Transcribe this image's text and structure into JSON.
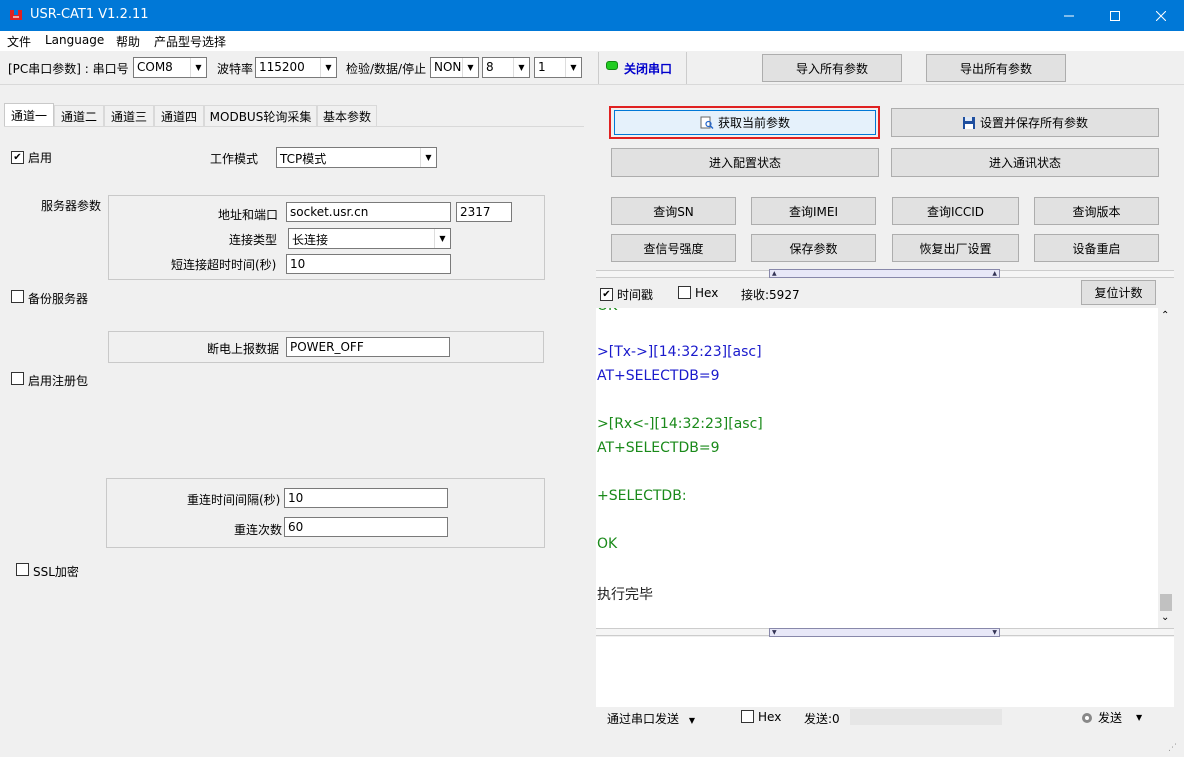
{
  "window": {
    "title": "USR-CAT1 V1.2.11"
  },
  "menu": [
    "文件",
    "Language",
    "帮助",
    "产品型号选择"
  ],
  "toolbar": {
    "pc_params_label": "[PC串口参数] : 串口号",
    "port_value": "COM8",
    "baud_label": "波特率",
    "baud_value": "115200",
    "check_label": "检验/数据/停止",
    "parity_value": "NONI",
    "databits_value": "8",
    "stopbits_value": "1",
    "close_port_label": "关闭串口",
    "import_label": "导入所有参数",
    "export_label": "导出所有参数"
  },
  "tabs": [
    "通道一",
    "通道二",
    "通道三",
    "通道四",
    "MODBUS轮询采集",
    "基本参数"
  ],
  "channel": {
    "enable_label": "启用",
    "work_mode_label": "工作模式",
    "work_mode_value": "TCP模式",
    "server_params_label": "服务器参数",
    "addr_port_label": "地址和端口",
    "addr_value": "socket.usr.cn",
    "port_value": "2317",
    "conn_type_label": "连接类型",
    "conn_type_value": "长连接",
    "short_timeout_label": "短连接超时时间(秒)",
    "short_timeout_value": "10",
    "backup_server_label": "备份服务器",
    "power_off_label": "断电上报数据",
    "power_off_value": "POWER_OFF",
    "register_label": "启用注册包",
    "reconnect_interval_label": "重连时间间隔(秒)",
    "reconnect_interval_value": "10",
    "reconnect_count_label": "重连次数",
    "reconnect_count_value": "60",
    "ssl_label": "SSL加密"
  },
  "actions": {
    "get_params": "获取当前参数",
    "save_all": "设置并保存所有参数",
    "enter_config": "进入配置状态",
    "enter_comm": "进入通讯状态",
    "query_sn": "查询SN",
    "query_imei": "查询IMEI",
    "query_iccid": "查询ICCID",
    "query_version": "查询版本",
    "query_signal": "查信号强度",
    "save_params": "保存参数",
    "factory_reset": "恢复出厂设置",
    "device_restart": "设备重启"
  },
  "log_options": {
    "timestamp_label": "时间戳",
    "hex_label": "Hex",
    "recv_label": "接收:5927",
    "reset_count_label": "复位计数"
  },
  "log": [
    {
      "text": "OK",
      "kind": "rx"
    },
    {
      "text": ">[Tx->][14:32:23][asc]",
      "kind": "tx"
    },
    {
      "text": "AT+SELECTDB=9",
      "kind": "tx"
    },
    {
      "text": ">[Rx<-][14:32:23][asc]",
      "kind": "rx"
    },
    {
      "text": "AT+SELECTDB=9",
      "kind": "rx"
    },
    {
      "text": "+SELECTDB:",
      "kind": "rx"
    },
    {
      "text": "OK",
      "kind": "rx"
    },
    {
      "text": "执行完毕",
      "kind": "plain"
    }
  ],
  "send": {
    "via_label": "通过串口发送",
    "hex_label": "Hex",
    "sent_label": "发送:0",
    "send_button": "发送"
  },
  "colors": {
    "titlebar": "#0078d7",
    "highlight_red": "#e02020",
    "tx": "#1a1acc",
    "rx": "#1a8a1a",
    "status_green": "#22cc22"
  }
}
